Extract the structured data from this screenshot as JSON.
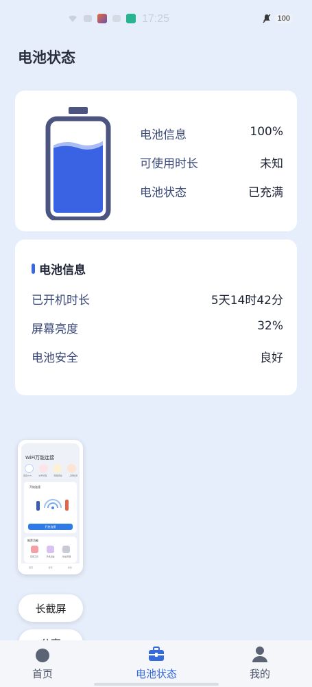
{
  "status_bar": {
    "time": "17:25",
    "battery_level": "100",
    "icons": [
      "wifi-icon",
      "sim-icon",
      "app-icon",
      "message-icon",
      "shield-icon"
    ]
  },
  "page": {
    "title": "电池状态"
  },
  "summary": {
    "battery_level_fraction": 0.8,
    "rows": [
      {
        "label": "电池信息",
        "value": "100%"
      },
      {
        "label": "可使用时长",
        "value": "未知"
      },
      {
        "label": "电池状态",
        "value": "已充满"
      }
    ]
  },
  "info_card": {
    "title": "电池信息",
    "rows": [
      {
        "label": "已开机时长",
        "value": "5天14时42分"
      },
      {
        "label": "屏幕亮度",
        "value": "32%"
      },
      {
        "label": "电池安全",
        "value": "良好"
      }
    ]
  },
  "screenshot_thumbnail": {
    "title": "WiFi万能连接",
    "icon_labels": [
      "连接WiFi",
      "信号增强",
      "网络测速",
      "上网检测"
    ],
    "card_title": "开始连接",
    "card_button": "开启连接",
    "card2_title": "推荐功能",
    "card2_labels": [
      "实用工具",
      "手机加速",
      "快速清理"
    ],
    "nav_labels": [
      "首页",
      "发现",
      "我的"
    ]
  },
  "floating_actions": {
    "long_screenshot": "长截屏",
    "share": "分享"
  },
  "tab_bar": {
    "tabs": [
      {
        "label": "首页",
        "icon": "home-icon"
      },
      {
        "label": "电池状态",
        "icon": "toolbox-icon",
        "active": true
      },
      {
        "label": "我的",
        "icon": "user-icon"
      }
    ]
  },
  "colors": {
    "background": "#e7eefb",
    "accent": "#3569de",
    "battery_fill": "#3a63e3",
    "battery_outline": "#4b5580"
  }
}
